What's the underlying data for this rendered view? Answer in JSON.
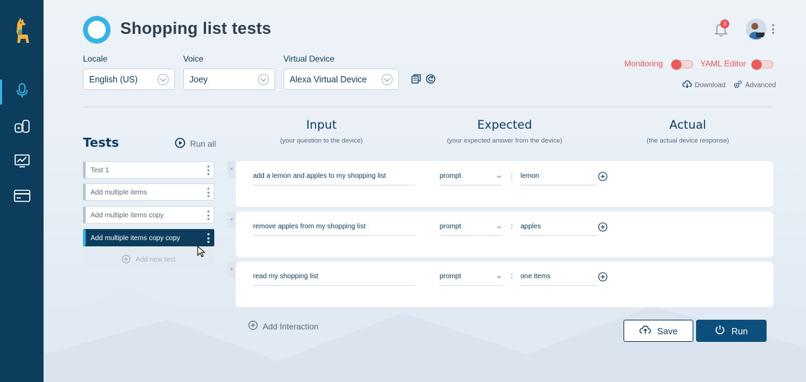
{
  "header": {
    "title": "Shopping list tests",
    "notifications_count": "3"
  },
  "fields": {
    "locale": {
      "label": "Locale",
      "value": "English (US)"
    },
    "voice": {
      "label": "Voice",
      "value": "Joey"
    },
    "virtual_device": {
      "label": "Virtual Device",
      "value": "Alexa Virtual Device"
    }
  },
  "toggles": {
    "monitoring": {
      "label": "Monitoring",
      "on": false
    },
    "yaml_editor": {
      "label": "YAML Editor",
      "on": false
    }
  },
  "links": {
    "download": "Download",
    "advanced": "Advanced"
  },
  "tests": {
    "heading": "Tests",
    "run_all": "Run all",
    "items": [
      {
        "label": "Test 1",
        "active": false
      },
      {
        "label": "Add multiple items",
        "active": false
      },
      {
        "label": "Add multiple items copy",
        "active": false
      },
      {
        "label": "Add multiple items copy copy",
        "active": true
      }
    ],
    "add_new": "Add new test"
  },
  "columns": {
    "input": {
      "title": "Input",
      "subtitle": "(your question to the device)"
    },
    "expected": {
      "title": "Expected",
      "subtitle": "(your expected answer from the device)"
    },
    "actual": {
      "title": "Actual",
      "subtitle": "(the actual device response)"
    }
  },
  "interactions": [
    {
      "input": "add a lemon and apples to my shopping list",
      "operator": "prompt",
      "expected": "lemon"
    },
    {
      "input": "remove apples from my shopping list",
      "operator": "prompt",
      "expected": "apples"
    },
    {
      "input": "read my shopping list",
      "operator": "prompt",
      "expected": "one items"
    }
  ],
  "row_close": "×",
  "separator": ":",
  "add_interaction": "Add Interaction",
  "buttons": {
    "save": "Save",
    "run": "Run"
  },
  "colors": {
    "sidebar": "#0c3d5d",
    "accent": "#32b4e6",
    "primary_button": "#0c4e7c",
    "toggle_off": "#ea5b5b",
    "badge": "#ef5350"
  }
}
